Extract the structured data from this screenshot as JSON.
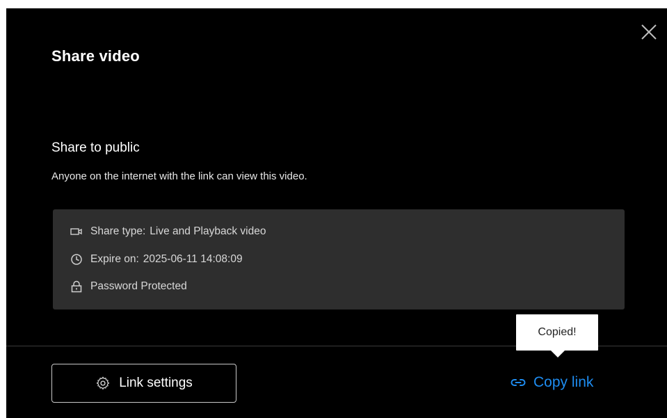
{
  "dialog": {
    "title": "Share video",
    "close_icon": "close-icon"
  },
  "share_section": {
    "title": "Share to public",
    "description": "Anyone on the internet with the link can view this video."
  },
  "info": {
    "share_type_label": "Share type:",
    "share_type_value": "Live and Playback video",
    "share_type_icon": "video-camera-icon",
    "expire_label": "Expire on:",
    "expire_value": "2025-06-11 14:08:09",
    "expire_icon": "clock-icon",
    "password_text": "Password Protected",
    "password_icon": "lock-icon"
  },
  "footer": {
    "link_settings_label": "Link settings",
    "link_settings_icon": "gear-icon",
    "copy_link_label": "Copy link",
    "copy_link_icon": "link-icon"
  },
  "tooltip": {
    "text": "Copied!"
  },
  "colors": {
    "dialog_bg": "#000000",
    "info_box_bg": "#2e2e2e",
    "accent": "#1e8cf0",
    "tooltip_bg": "#ffffff"
  }
}
